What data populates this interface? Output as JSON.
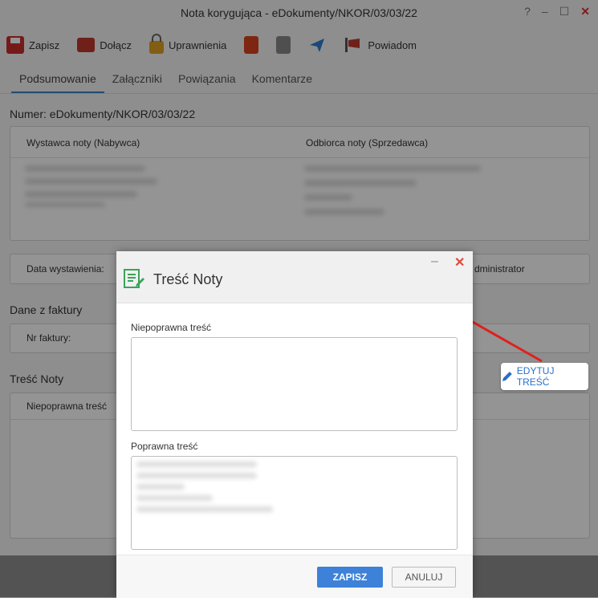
{
  "window": {
    "title": "Nota korygująca - eDokumenty/NKOR/03/03/22",
    "controls": {
      "help": "?",
      "minimize": "–",
      "maximize": "☐",
      "close": "✕"
    }
  },
  "toolbar": {
    "save": "Zapisz",
    "attach": "Dołącz",
    "permissions": "Uprawnienia",
    "notify": "Powiadom"
  },
  "tabs": [
    "Podsumowanie",
    "Załączniki",
    "Powiązania",
    "Komentarze"
  ],
  "active_tab": "Podsumowanie",
  "doc": {
    "number_label": "Numer: eDokumenty/NKOR/03/03/22",
    "issuer_header": "Wystawca noty (Nabywca)",
    "recipient_header": "Odbiorca noty (Sprzedawca)",
    "issue_date_label": "Data wystawienia:",
    "admin_partial": "dministrator",
    "invoice_section": "Dane z faktury",
    "invoice_number_label": "Nr faktury:",
    "note_section": "Treść Noty",
    "incorrect_label": "Niepoprawna treść"
  },
  "edit_button": {
    "label": "EDYTUJ TREŚĆ"
  },
  "modal": {
    "title": "Treść Noty",
    "min": "–",
    "close": "✕",
    "incorrect_label": "Niepoprawna treść",
    "incorrect_value": "",
    "correct_label": "Poprawna treść",
    "save": "ZAPISZ",
    "cancel": "ANULUJ"
  },
  "colors": {
    "accent": "#3d82d8",
    "arrow": "#e0201c",
    "close": "#e04a3a"
  }
}
